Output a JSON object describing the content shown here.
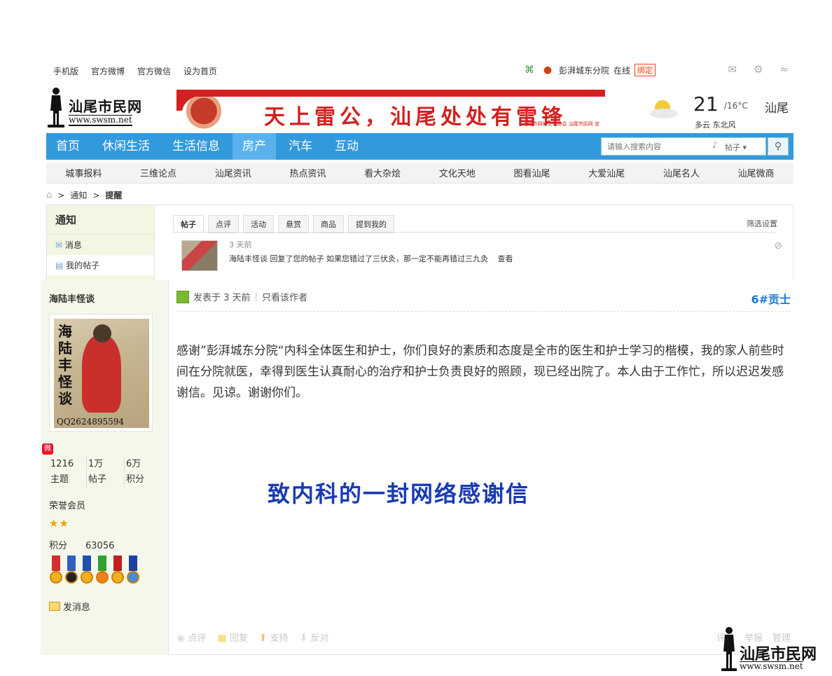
{
  "topbar": {
    "links": [
      "手机版",
      "官方微博",
      "官方微信",
      "设为首页"
    ],
    "user": "彭湃城东分院",
    "status": "在线",
    "bind": "绑定"
  },
  "header": {
    "logo_text": "汕尾市民网",
    "logo_url": "www.swsm.net",
    "banner_slogan": "天上雷公，汕尾处处有雷锋",
    "banner_sub": "汕尾市网络文化协会  汕尾市民网  宣",
    "weather": {
      "temp": "21",
      "range": "/16°C",
      "city": "汕尾",
      "desc": "多云 东北风"
    }
  },
  "nav": {
    "items": [
      "首页",
      "休闲生活",
      "生活信息",
      "房产",
      "汽车",
      "互动"
    ],
    "active_index": 3,
    "search_placeholder": "请输入搜索内容",
    "search_type": "帖子"
  },
  "subnav": [
    "城事报料",
    "三维论点",
    "汕尾资讯",
    "热点资讯",
    "看大杂烩",
    "文化天地",
    "图看汕尾",
    "大爱汕尾",
    "汕尾名人",
    "汕尾微商"
  ],
  "breadcrumb": [
    "通知",
    "提醒"
  ],
  "notice": {
    "title": "通知",
    "menu": [
      "消息",
      "我的帖子"
    ],
    "tabs": [
      "帖子",
      "点评",
      "活动",
      "悬赏",
      "商品",
      "提到我的"
    ],
    "filter": "筛选设置",
    "item": {
      "time": "3 天前",
      "text": "海陆丰怪谈 回复了您的帖子 如果您错过了三伏灸，那一定不能再错过三九灸",
      "link": "查看"
    }
  },
  "post": {
    "author": "海陆丰怪谈",
    "avatar_text": "海陆丰怪谈",
    "avatar_qq": "QQ2624895594",
    "stats": [
      {
        "value": "1216",
        "label": "主题"
      },
      {
        "value": "1万",
        "label": "帖子"
      },
      {
        "value": "6万",
        "label": "积分"
      }
    ],
    "honor": "荣誉会员",
    "stars": "★★",
    "points_label": "积分",
    "points_value": "63056",
    "send_msg": "发消息",
    "posted": "发表于 3 天前",
    "only_author": "只看该作者",
    "floor": "6#贡士",
    "body": "感谢”彭湃城东分院“内科全体医生和护士，你们良好的素质和态度是全市的医生和护士学习的楷模，我的家人前些时间在分院就医，幸得到医生认真耐心的治疗和护士负责良好的照顾，现已经出院了。本人由于工作忙，所以迟迟发感谢信。见谅。谢谢你们。",
    "headline": "致内科的一封网络感谢信",
    "actions": [
      "点评",
      "回复",
      "支持",
      "反对"
    ],
    "actions_right": [
      "评分",
      "举报",
      "管理"
    ]
  },
  "watermark": {
    "text": "汕尾市民网",
    "url": "www.swsm.net"
  },
  "colors": {
    "nav_bg": "#3399dd",
    "nav_active": "#5ab2ec",
    "headline": "#1a3ab0",
    "floor": "#1a7ad6",
    "side_bg": "#f4f8ea"
  }
}
